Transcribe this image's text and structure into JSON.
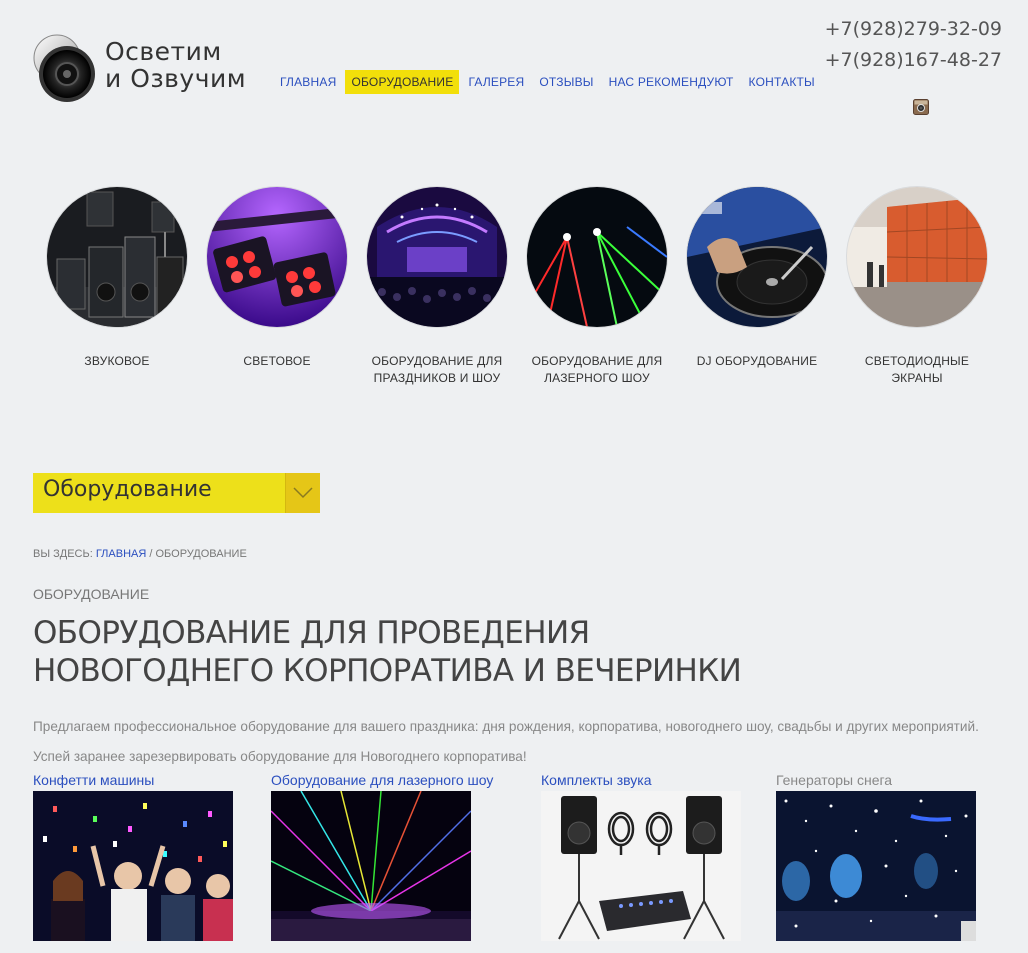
{
  "logo": {
    "line1": "Осветим",
    "line2": "и Озвучим"
  },
  "nav": [
    {
      "label": "ГЛАВНАЯ",
      "active": false
    },
    {
      "label": "ОБОРУДОВАНИЕ",
      "active": true
    },
    {
      "label": "ГАЛЕРЕЯ",
      "active": false
    },
    {
      "label": "ОТЗЫВЫ",
      "active": false
    },
    {
      "label": "НАС РЕКОМЕНДУЮТ",
      "active": false
    },
    {
      "label": "КОНТАКТЫ",
      "active": false
    }
  ],
  "phones": [
    "+7(928)279-32-09",
    "+7(928)167-48-27"
  ],
  "social": {
    "icon": "instagram-icon"
  },
  "categories": [
    {
      "label": "ЗВУКОВОЕ",
      "image": "speakers-image"
    },
    {
      "label": "СВЕТОВОЕ",
      "image": "stage-lights-image"
    },
    {
      "label": "ОБОРУДОВАНИЕ ДЛЯ ПРАЗДНИКОВ И ШОУ",
      "image": "concert-stage-image"
    },
    {
      "label": "ОБОРУДОВАНИЕ ДЛЯ ЛАЗЕРНОГО ШОУ",
      "image": "laser-show-image"
    },
    {
      "label": "DJ ОБОРУДОВАНИЕ",
      "image": "dj-turntable-image"
    },
    {
      "label": "СВЕТОДИОДНЫЕ ЭКРАНЫ",
      "image": "led-screen-image"
    }
  ],
  "dropdown": {
    "label": "Оборудование",
    "icon": "chevron-down-icon"
  },
  "breadcrumb": {
    "prefix": "ВЫ ЗДЕСЬ: ",
    "home": "ГЛАВНАЯ",
    "separator": " / ",
    "current": "ОБОРУДОВАНИЕ"
  },
  "section_label": "ОБОРУДОВАНИЕ",
  "title": "ОБОРУДОВАНИЕ ДЛЯ ПРОВЕДЕНИЯ НОВОГОДНЕГО КОРПОРАТИВА И ВЕЧЕРИНКИ",
  "intro": [
    "Предлагаем профессиональное оборудование для вашего праздника: дня рождения, корпоратива, новогоднего шоу, свадьбы и других мероприятий.",
    "Успей заранее зарезервировать оборудование для Новогоднего корпоратива!"
  ],
  "products": [
    {
      "title": "Конфетти машины",
      "link": true,
      "image": "confetti-party-image"
    },
    {
      "title": "Оборудование для лазерного шоу",
      "link": true,
      "image": "laser-beams-image"
    },
    {
      "title": "Комплекты звука",
      "link": true,
      "image": "sound-kit-image"
    },
    {
      "title": "Генераторы снега",
      "link": false,
      "image": "snow-machine-image"
    }
  ],
  "colors": {
    "accent": "#f2df0a",
    "link": "#2b4fbf",
    "background": "#eef0f2"
  }
}
